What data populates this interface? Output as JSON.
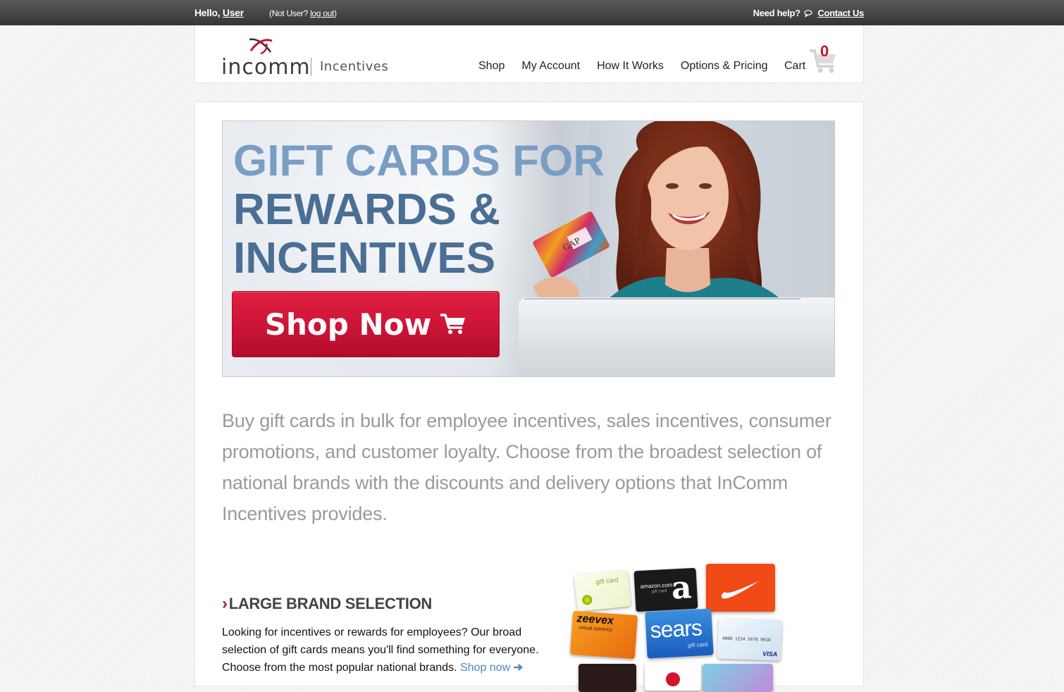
{
  "topbar": {
    "hello": "Hello,",
    "user": "User",
    "not_user_prefix": "(Not User?",
    "logout": "log out",
    "not_user_suffix": ")",
    "need_help": "Need help?",
    "contact": "Contact Us"
  },
  "header": {
    "logo_word": "incomm",
    "logo_sub": "Incentives",
    "nav": [
      "Shop",
      "My Account",
      "How It Works",
      "Options & Pricing"
    ],
    "cart_label": "Cart",
    "cart_count": "0"
  },
  "hero": {
    "line1": "GIFT CARDS FOR",
    "line2": "REWARDS &",
    "line3": "INCENTIVES",
    "cta": "Shop Now",
    "card_brand": "GAP"
  },
  "intro": "Buy gift cards in bulk for employee incentives, sales incentives, consumer promotions, and customer loyalty. Choose from the broadest selection of national brands with the discounts and delivery options that InComm Incentives provides.",
  "feature": {
    "title": "LARGE BRAND SELECTION",
    "text": "Looking for incentives or rewards for employees? Our broad selection of gift cards means you'll find something for everyone. Choose from the most popular national brands.",
    "link": "Shop now"
  },
  "cards": {
    "bp": "gift card",
    "amazon": "amazon.com",
    "amazon_sub": "gift card",
    "zeevex": "zeevex",
    "zeevex_sub": "virtual currency",
    "sears": "sears",
    "sears_sub": "gift card",
    "visa": "VISA",
    "visa_num": "4000 1234 5678 9010"
  },
  "colors": {
    "accent_red": "#c5142f",
    "hero_blue": "#4a6e94",
    "hero_light_blue": "#7a9dc4",
    "link_blue": "#4a86c8"
  }
}
